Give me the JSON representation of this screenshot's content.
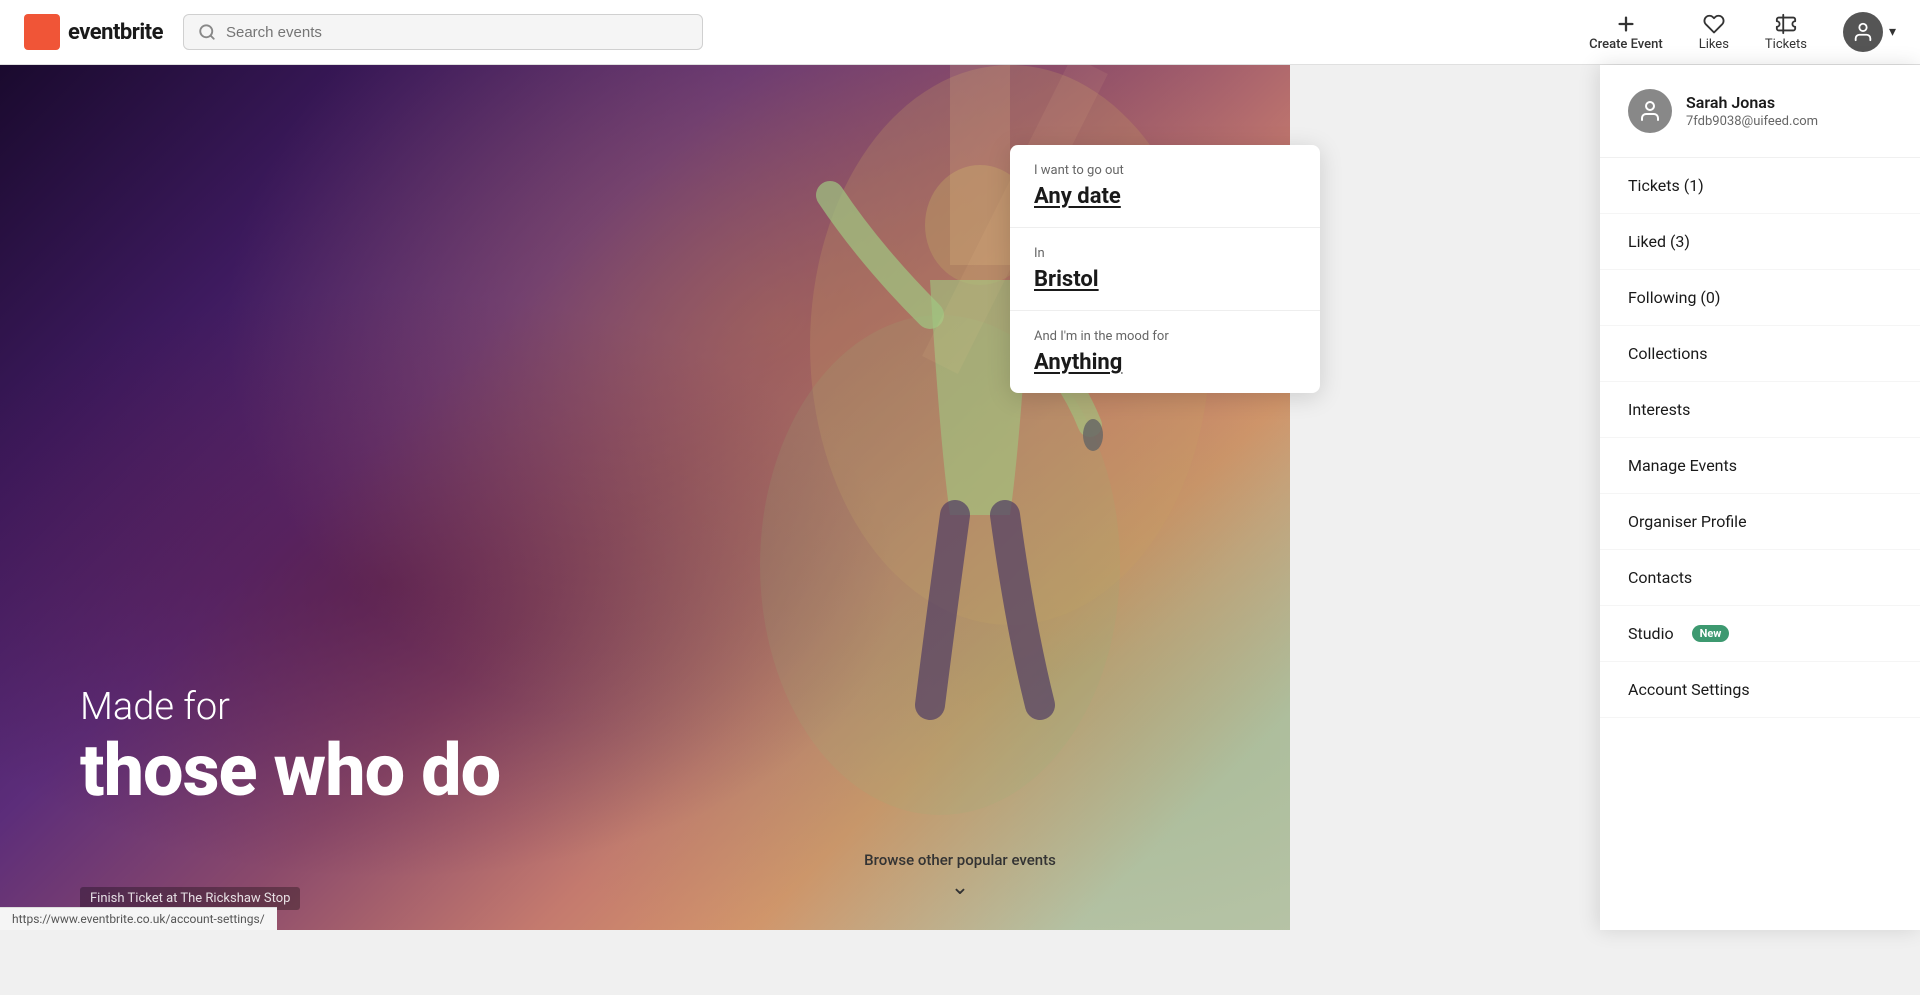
{
  "header": {
    "logo_text": "eventbrite",
    "search_placeholder": "Search events",
    "create_event_label": "Create Event",
    "likes_label": "Likes",
    "tickets_label": "Tickets",
    "chevron_label": "▾"
  },
  "hero": {
    "made_for": "Made for",
    "tagline": "those who do",
    "finish_ticket_label": "Finish Ticket at The Rickshaw Stop"
  },
  "search_widget": {
    "date_prompt": "I want to go out",
    "date_label": "Any date",
    "location_prompt": "In",
    "location_label": "Bristol",
    "mood_prompt": "And I'm in the mood for",
    "mood_label": "Anything"
  },
  "browse": {
    "label": "Browse other popular events",
    "chevron": "⌄"
  },
  "dropdown": {
    "user_name": "Sarah Jonas",
    "user_email": "7fdb9038@uifeed.com",
    "items": [
      {
        "label": "Tickets (1)",
        "key": "tickets"
      },
      {
        "label": "Liked (3)",
        "key": "liked"
      },
      {
        "label": "Following (0)",
        "key": "following"
      },
      {
        "label": "Collections",
        "key": "collections"
      },
      {
        "label": "Interests",
        "key": "interests"
      },
      {
        "label": "Manage Events",
        "key": "manage-events"
      },
      {
        "label": "Organiser Profile",
        "key": "organiser-profile"
      },
      {
        "label": "Contacts",
        "key": "contacts"
      },
      {
        "label": "Studio",
        "key": "studio",
        "badge": "New"
      },
      {
        "label": "Account Settings",
        "key": "account-settings"
      }
    ]
  },
  "status_bar": {
    "url": "https://www.eventbrite.co.uk/account-settings/"
  }
}
